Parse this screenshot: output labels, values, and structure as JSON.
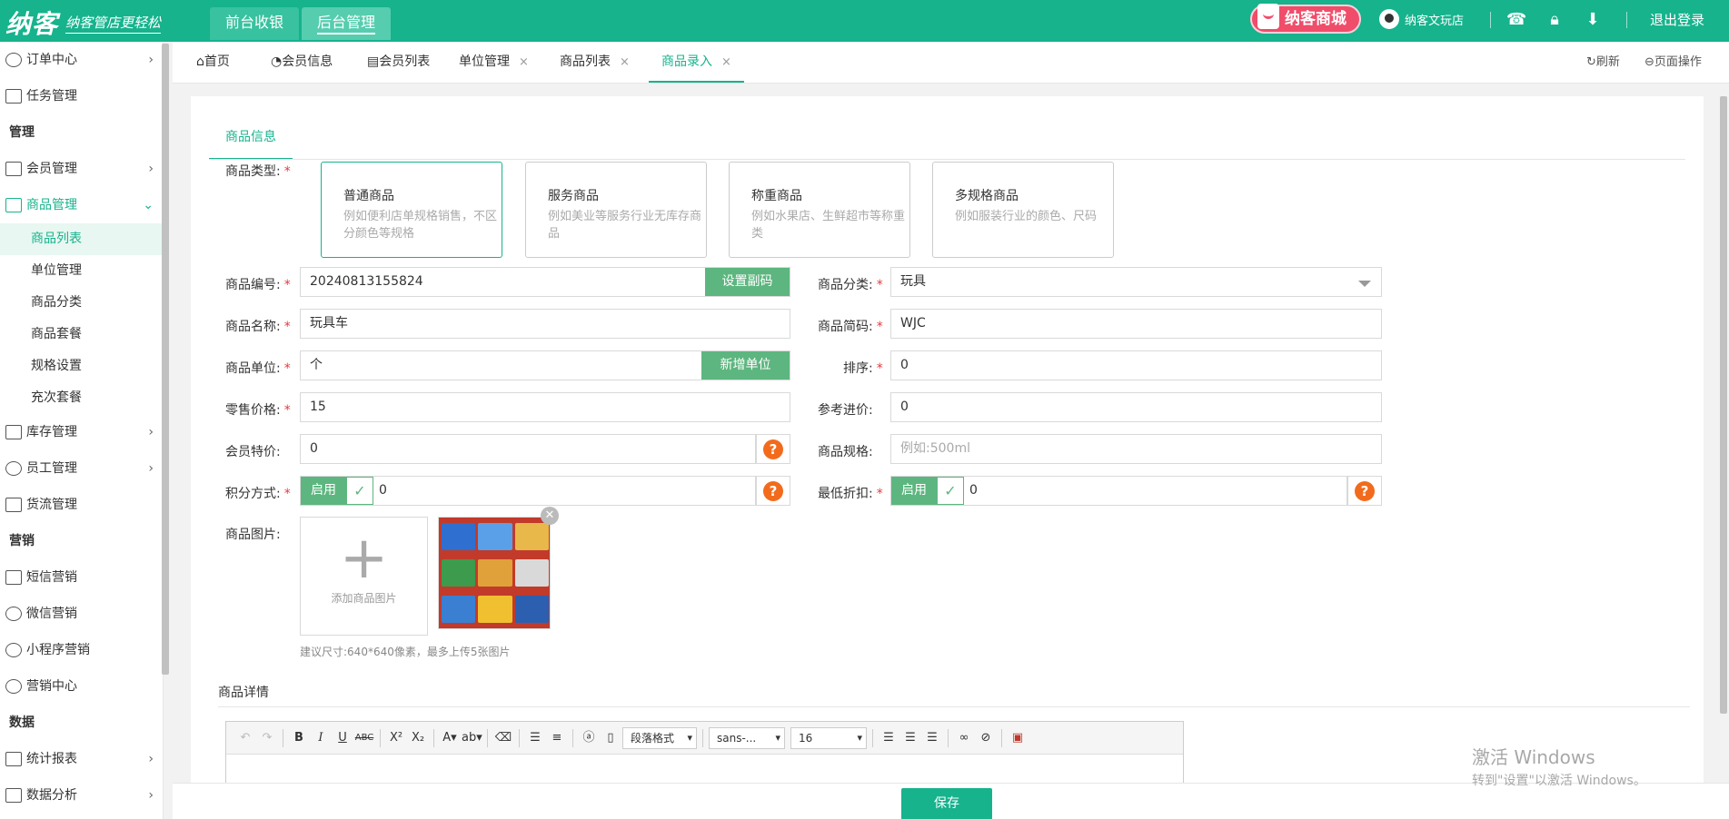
{
  "topbar": {
    "logo": "纳客",
    "slogan": "纳客管店更轻松",
    "tabs": [
      "前台收银",
      "后台管理"
    ],
    "mall": "纳客商城",
    "user": "纳客文玩店",
    "logout": "退出登录"
  },
  "sidebar": {
    "items": [
      {
        "label": "订单中心",
        "icon": "order-icon",
        "arrow": "›"
      },
      {
        "label": "任务管理",
        "icon": "task-icon"
      },
      {
        "group": "管理"
      },
      {
        "label": "会员管理",
        "icon": "crown-icon",
        "arrow": "›"
      },
      {
        "label": "商品管理",
        "icon": "goods-icon",
        "arrow": "⌄"
      },
      {
        "label": "库存管理",
        "icon": "stock-icon",
        "arrow": "›"
      },
      {
        "label": "员工管理",
        "icon": "staff-icon",
        "arrow": "›"
      },
      {
        "label": "货流管理",
        "icon": "truck-icon"
      },
      {
        "group": "营销"
      },
      {
        "label": "短信营销",
        "icon": "mail-icon"
      },
      {
        "label": "微信营销",
        "icon": "wechat-icon"
      },
      {
        "label": "小程序营销",
        "icon": "miniapp-icon"
      },
      {
        "label": "营销中心",
        "icon": "target-icon"
      },
      {
        "group": "数据"
      },
      {
        "label": "统计报表",
        "icon": "bar-chart-icon",
        "arrow": "›"
      },
      {
        "label": "数据分析",
        "icon": "monitor-icon",
        "arrow": "›"
      }
    ],
    "goods_sub": [
      "商品列表",
      "单位管理",
      "商品分类",
      "商品套餐",
      "规格设置",
      "充次套餐"
    ]
  },
  "pagetabs": {
    "tabs": [
      "首页",
      "会员信息",
      "会员列表",
      "单位管理",
      "商品列表",
      "商品录入"
    ],
    "close": "×",
    "refresh": "刷新",
    "page_ops": "页面操作"
  },
  "form": {
    "section_tab": "商品信息",
    "type_label": "商品类型:",
    "types": [
      {
        "title": "普通商品",
        "desc": "例如便利店单规格销售，不区分颜色等规格"
      },
      {
        "title": "服务商品",
        "desc": "例如美业等服务行业无库存商品"
      },
      {
        "title": "称重商品",
        "desc": "例如水果店、生鲜超市等称重类"
      },
      {
        "title": "多规格商品",
        "desc": "例如服装行业的颜色、尺码"
      }
    ],
    "code_label": "商品编号:",
    "code_value": "20240813155824",
    "set_barcode": "设置副码",
    "category_label": "商品分类:",
    "category_value": "玩具",
    "name_label": "商品名称:",
    "name_value": "玩具车",
    "short_label": "商品简码:",
    "short_value": "WJC",
    "unit_label": "商品单位:",
    "unit_value": "个",
    "add_unit": "新增单位",
    "sort_label": "排序:",
    "sort_value": "0",
    "price_label": "零售价格:",
    "price_value": "15",
    "cost_label": "参考进价:",
    "cost_value": "0",
    "member_label": "会员特价:",
    "member_value": "0",
    "spec_label": "商品规格:",
    "spec_placeholder": "例如:500ml",
    "points_label": "积分方式:",
    "points_toggle": "启用",
    "points_value": "0",
    "discount_label": "最低折扣:",
    "discount_toggle": "启用",
    "discount_value": "0",
    "image_label": "商品图片:",
    "add_image": "添加商品图片",
    "image_hint": "建议尺寸:640*640像素，最多上传5张图片",
    "qmark": "?",
    "check": "✓",
    "plus": "+"
  },
  "detail": {
    "title": "商品详情",
    "paragraph": "段落格式",
    "font": "sans-...",
    "size": "16"
  },
  "save": "保存",
  "watermark": {
    "line1": "激活 Windows",
    "line2": "转到\"设置\"以激活 Windows。"
  },
  "colors": {
    "brand": "#16b38d",
    "button_green": "#5db67f",
    "help_orange": "#f26b1d"
  }
}
